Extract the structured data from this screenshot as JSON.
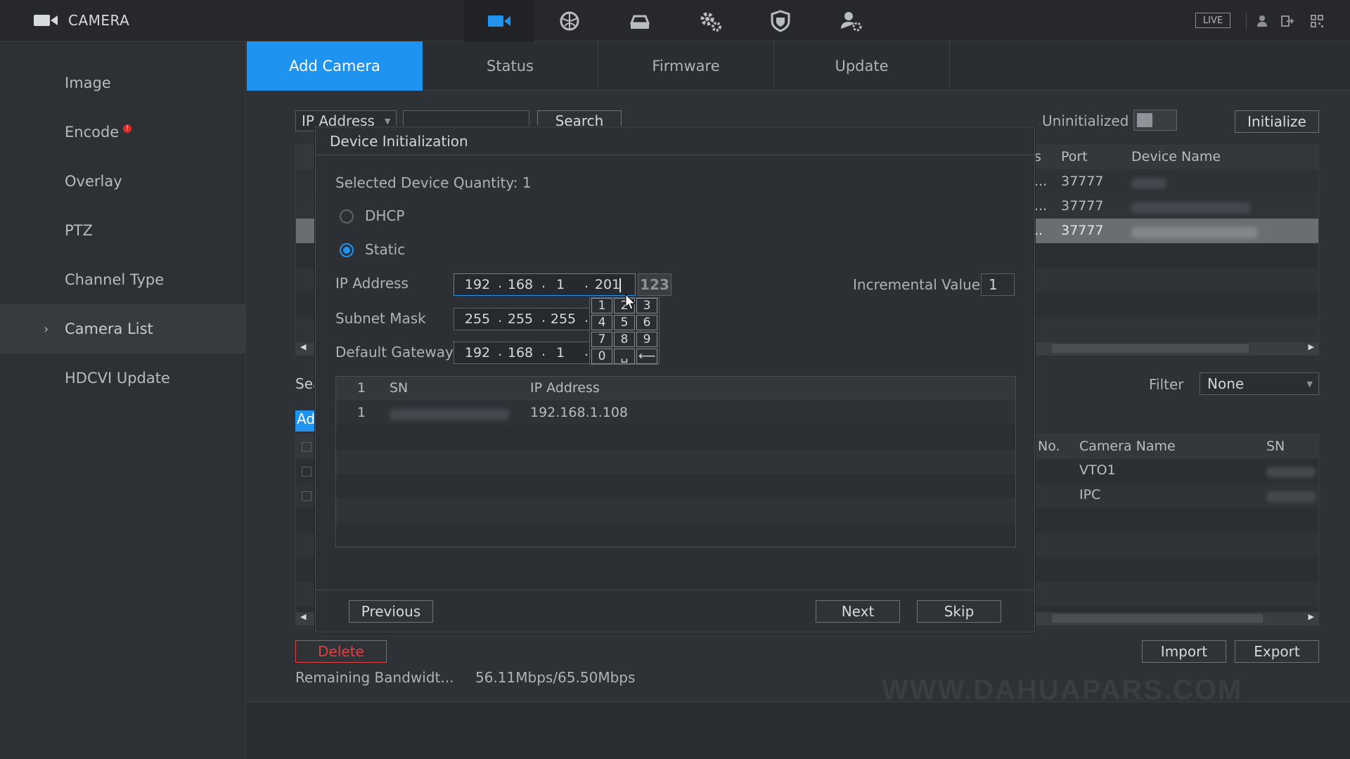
{
  "app": {
    "title": "CAMERA",
    "live": "LIVE"
  },
  "top_icons": [
    "camera-icon",
    "network-icon",
    "storage-icon",
    "system-settings-icon",
    "security-shield-icon",
    "account-icon"
  ],
  "sidebar": {
    "items": [
      {
        "label": "Image"
      },
      {
        "label": "Encode",
        "badge": "!"
      },
      {
        "label": "Overlay"
      },
      {
        "label": "PTZ"
      },
      {
        "label": "Channel Type"
      },
      {
        "label": "Camera List",
        "active": true,
        "chevron": "›"
      },
      {
        "label": "HDCVI Update"
      }
    ]
  },
  "tabs": [
    "Add Camera",
    "Status",
    "Firmware",
    "Update"
  ],
  "search_bar": {
    "type_select": "IP Address",
    "search_button": "Search",
    "uninitialized_label": "Uninitialized",
    "initialize_button": "Initialize"
  },
  "device_table": {
    "headers": {
      "status_partial": "s",
      "port": "Port",
      "device_name": "Device Name"
    },
    "rows": [
      {
        "status_partial": "...",
        "port": "37777"
      },
      {
        "status_partial": "...",
        "port": "37777"
      },
      {
        "status_partial": "..",
        "port": "37777"
      }
    ]
  },
  "added_section": {
    "search_partial": "Sea",
    "add_partial": "Ad",
    "filter_label": "Filter",
    "filter_value": "None",
    "headers": {
      "no": "No.",
      "camera_name": "Camera Name",
      "sn": "SN"
    },
    "rows": [
      {
        "camera_name": "VTO1"
      },
      {
        "camera_name": "IPC"
      }
    ]
  },
  "footer": {
    "delete_button": "Delete",
    "import_button": "Import",
    "export_button": "Export",
    "bandwidth_label": "Remaining Bandwidt...",
    "bandwidth_value": "56.11Mbps/65.50Mbps"
  },
  "watermark": "WWW.DAHUAPARS.COM",
  "modal": {
    "title": "Device Initialization",
    "selected_quantity": "Selected Device Quantity: 1",
    "dhcp_label": "DHCP",
    "static_label": "Static",
    "ip_label": "IP Address",
    "ip": [
      "192",
      "168",
      "1",
      "201"
    ],
    "subnet_label": "Subnet Mask",
    "subnet": [
      "255",
      "255",
      "255"
    ],
    "gateway_label": "Default Gateway",
    "gateway": [
      "192",
      "168",
      "1"
    ],
    "keypad_toggle": "123",
    "keys": [
      "1",
      "2",
      "3",
      "4",
      "5",
      "6",
      "7",
      "8",
      "9",
      "0",
      "␣",
      "⟵"
    ],
    "incremental_label": "Incremental Value",
    "incremental_value": "1",
    "table_headers": {
      "index": "1",
      "sn": "SN",
      "ip": "IP Address"
    },
    "table_rows": [
      {
        "index": "1",
        "ip": "192.168.1.108"
      }
    ],
    "previous_button": "Previous",
    "next_button": "Next",
    "skip_button": "Skip"
  },
  "colors": {
    "accent": "#1f93f0",
    "danger": "#e04040",
    "background": "#2e3136"
  }
}
